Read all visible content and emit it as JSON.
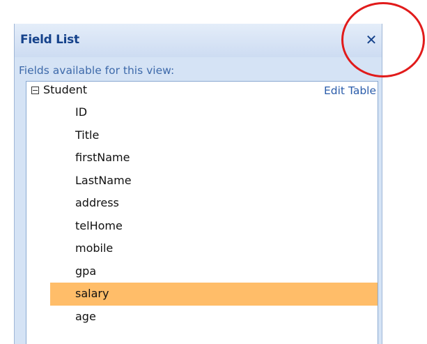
{
  "pane": {
    "title": "Field List",
    "close_glyph": "✕",
    "caption": "Fields available for this view:"
  },
  "table": {
    "expander_state": "collapse",
    "name": "Student",
    "edit_link": "Edit Table",
    "fields": [
      {
        "label": "ID",
        "selected": false
      },
      {
        "label": "Title",
        "selected": false
      },
      {
        "label": "firstName",
        "selected": false
      },
      {
        "label": "LastName",
        "selected": false
      },
      {
        "label": "address",
        "selected": false
      },
      {
        "label": "telHome",
        "selected": false
      },
      {
        "label": "mobile",
        "selected": false
      },
      {
        "label": "gpa",
        "selected": false
      },
      {
        "label": "salary",
        "selected": true
      },
      {
        "label": "age",
        "selected": false
      }
    ]
  },
  "icons": {
    "close": "close-icon",
    "expander": "collapse-minus-icon"
  },
  "colors": {
    "title_text": "#15428b",
    "pane_background": "#d5e3f5",
    "selected_row": "#ffbd69",
    "link_text": "#2a5caa",
    "annotation_circle": "#e11b1b"
  }
}
